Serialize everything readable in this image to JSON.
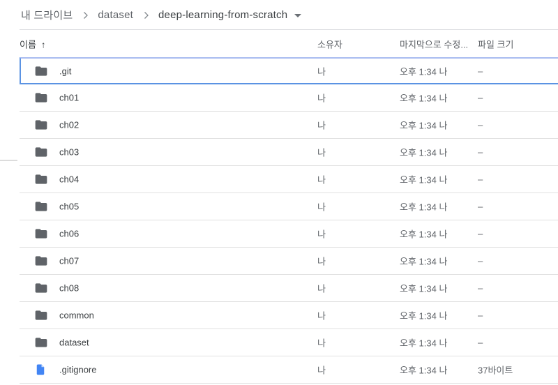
{
  "breadcrumb": {
    "items": [
      "내 드라이브",
      "dataset",
      "deep-learning-from-scratch"
    ]
  },
  "table": {
    "header": {
      "name": "이름",
      "sort_arrow": "↑",
      "owner": "소유자",
      "modified": "마지막으로 수정...",
      "size": "파일 크기"
    },
    "rows": [
      {
        "name": ".git",
        "type": "folder",
        "owner": "나",
        "modified": "오후 1:34 나",
        "size": "–",
        "selected": true
      },
      {
        "name": "ch01",
        "type": "folder",
        "owner": "나",
        "modified": "오후 1:34 나",
        "size": "–"
      },
      {
        "name": "ch02",
        "type": "folder",
        "owner": "나",
        "modified": "오후 1:34 나",
        "size": "–"
      },
      {
        "name": "ch03",
        "type": "folder",
        "owner": "나",
        "modified": "오후 1:34 나",
        "size": "–"
      },
      {
        "name": "ch04",
        "type": "folder",
        "owner": "나",
        "modified": "오후 1:34 나",
        "size": "–"
      },
      {
        "name": "ch05",
        "type": "folder",
        "owner": "나",
        "modified": "오후 1:34 나",
        "size": "–"
      },
      {
        "name": "ch06",
        "type": "folder",
        "owner": "나",
        "modified": "오후 1:34 나",
        "size": "–"
      },
      {
        "name": "ch07",
        "type": "folder",
        "owner": "나",
        "modified": "오후 1:34 나",
        "size": "–"
      },
      {
        "name": "ch08",
        "type": "folder",
        "owner": "나",
        "modified": "오후 1:34 나",
        "size": "–"
      },
      {
        "name": "common",
        "type": "folder",
        "owner": "나",
        "modified": "오후 1:34 나",
        "size": "–"
      },
      {
        "name": "dataset",
        "type": "folder",
        "owner": "나",
        "modified": "오후 1:34 나",
        "size": "–"
      },
      {
        "name": ".gitignore",
        "type": "file",
        "owner": "나",
        "modified": "오후 1:34 나",
        "size": "37바이트"
      }
    ]
  },
  "icons": {
    "breadcrumb_separator": "chevron-right",
    "dropdown": "caret-down",
    "sort": "arrow-up",
    "folder": "folder",
    "file": "file-document"
  },
  "colors": {
    "accent_blue": "#4285f4",
    "file_fold_blue": "#c6dafc",
    "folder_gray": "#5f6368",
    "text_dark": "#3c4043",
    "text_secondary": "#5f6368",
    "divider": "#e0e0e0",
    "selection_border": "#5b93e3"
  }
}
